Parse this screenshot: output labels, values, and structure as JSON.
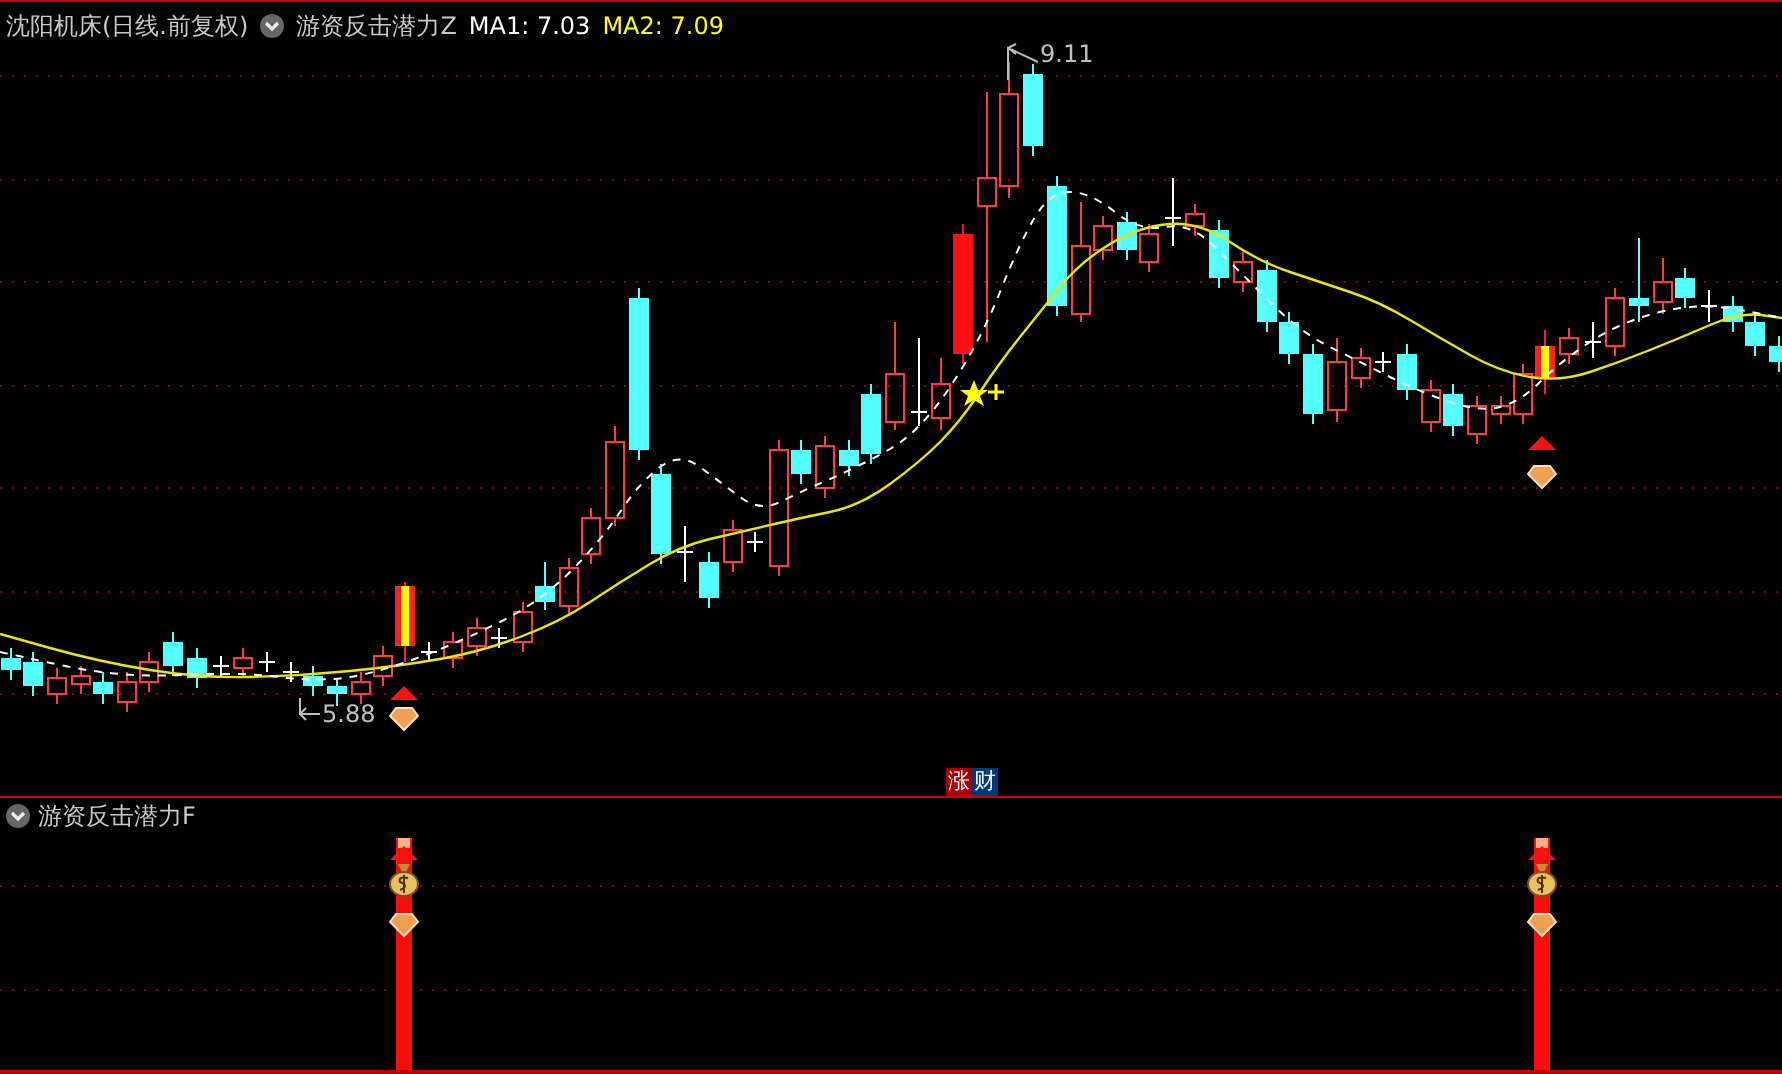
{
  "main_chart": {
    "title": "沈阳机床(日线.前复权)",
    "indicator": "游资反击潜力Z",
    "ma_readings": [
      {
        "label": "MA1: 7.03",
        "color": "#ffffff"
      },
      {
        "label": "MA2: 7.09",
        "color": "#ffff00"
      }
    ],
    "price_labels": [
      {
        "kind": "high",
        "text": "9.11"
      },
      {
        "kind": "low",
        "text": "5.88"
      }
    ],
    "signal_badge": [
      {
        "text": "涨",
        "color": "#a80000"
      },
      {
        "text": "财",
        "color": "#003a78"
      }
    ]
  },
  "sub_panel": {
    "title": "游资反击潜力F"
  }
}
